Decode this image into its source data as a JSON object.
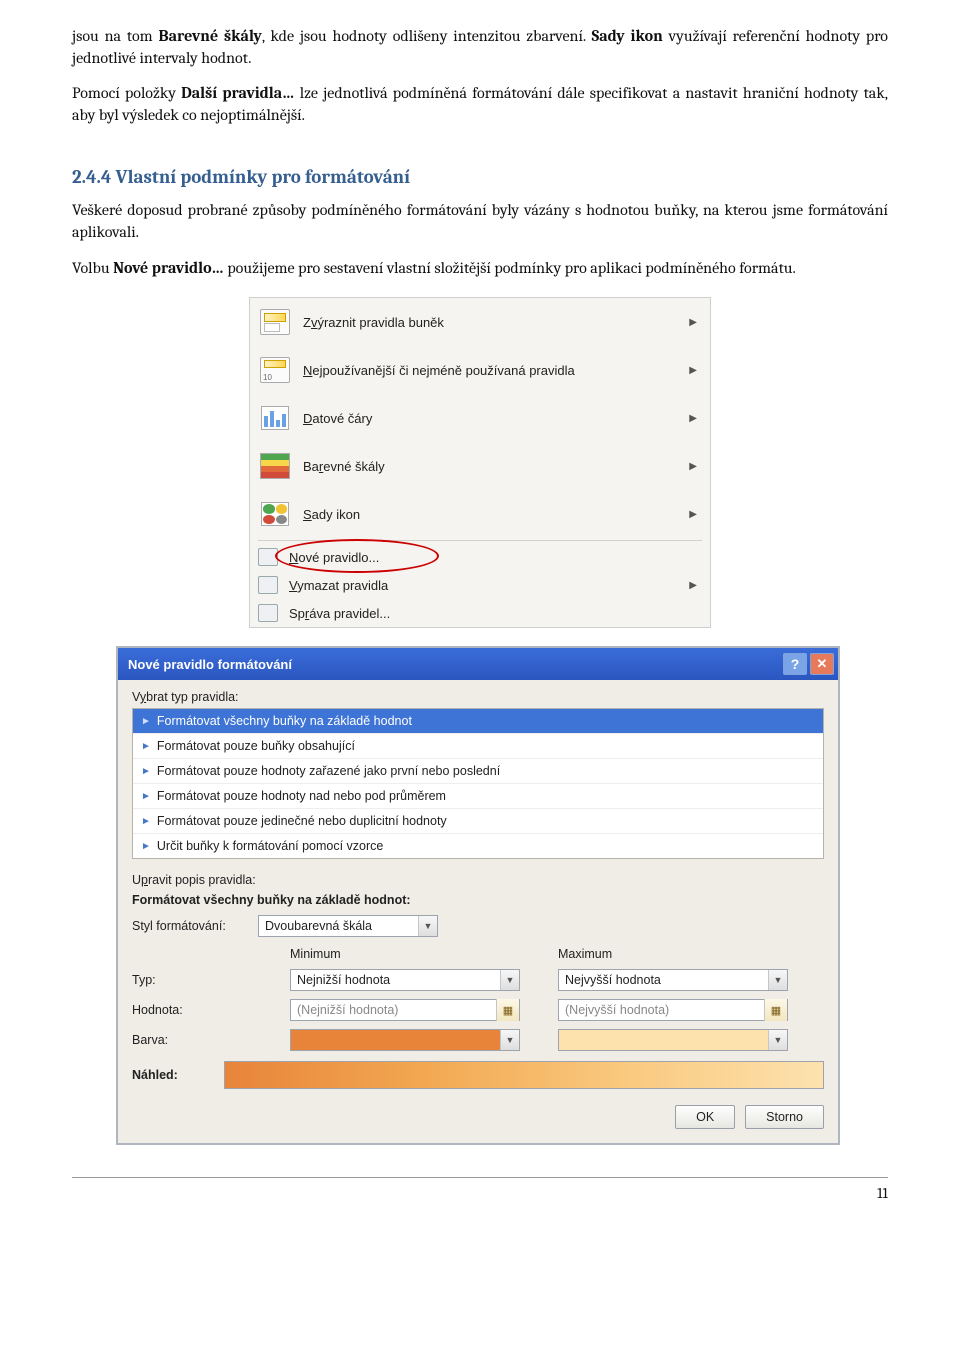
{
  "para1_pre": "jsou na tom ",
  "para1_b1": "Barevné škály",
  "para1_mid": ", kde jsou hodnoty odlišeny intenzitou zbarvení. ",
  "para1_b2": "Sady ikon",
  "para1_post": " využívají referenční hodnoty pro jednotlivé intervaly hodnot.",
  "para2_pre": "Pomocí položky ",
  "para2_b": "Další pravidla…",
  "para2_post": " lze jednotlivá podmíněná formátování dále specifikovat a nastavit hraniční hodnoty tak, aby byl výsledek co nejoptimálnější.",
  "heading": "2.4.4 Vlastní podmínky pro formátování",
  "para3": "Veškeré doposud probrané způsoby podmíněného formátování byly vázány s hodnotou buňky, na kterou jsme formátování aplikovali.",
  "para4_pre": "Volbu ",
  "para4_b": "Nové pravidlo…",
  "para4_post": " použijeme pro sestavení vlastní složitější podmínky pro aplikaci podmíněného formátu.",
  "menu": {
    "items": [
      {
        "label_pre": "Z",
        "label_ul": "v",
        "label_post": "ýraznit pravidla buněk",
        "sub": true,
        "icon": "highlight"
      },
      {
        "label_pre": "",
        "label_ul": "N",
        "label_post": "ejpoužívanější či nejméně používaná pravidla",
        "sub": true,
        "icon": "top10"
      },
      {
        "label_pre": "",
        "label_ul": "D",
        "label_post": "atové čáry",
        "sub": true,
        "icon": "bars"
      },
      {
        "label_pre": "Ba",
        "label_ul": "r",
        "label_post": "evné škály",
        "sub": true,
        "icon": "scale"
      },
      {
        "label_pre": "",
        "label_ul": "S",
        "label_post": "ady ikon",
        "sub": true,
        "icon": "icons"
      }
    ],
    "items2": [
      {
        "label_pre": "",
        "label_ul": "N",
        "label_post": "ové pravidlo...",
        "circle": true
      },
      {
        "label_pre": "",
        "label_ul": "V",
        "label_post": "ymazat pravidla",
        "sub": true
      },
      {
        "label_pre": "Sp",
        "label_ul": "r",
        "label_post": "áva pravidel..."
      }
    ]
  },
  "dialog": {
    "title": "Nové pravidlo formátování",
    "label_select_pre": "V",
    "label_select_ul": "y",
    "label_select_post": "brat typ pravidla:",
    "rules": [
      "Formátovat všechny buňky na základě hodnot",
      "Formátovat pouze buňky obsahující",
      "Formátovat pouze hodnoty zařazené jako první nebo poslední",
      "Formátovat pouze hodnoty nad nebo pod průměrem",
      "Formátovat pouze jedinečné nebo duplicitní hodnoty",
      "Určit buňky k formátování pomocí vzorce"
    ],
    "label_edit_pre": "U",
    "label_edit_ul": "p",
    "label_edit_post": "ravit popis pravidla:",
    "subhead": "Formátovat všechny buňky na základě hodnot:",
    "style_label": "Styl formátování:",
    "style_value": "Dvoubarevná škála",
    "col_min": "Minimum",
    "col_max": "Maximum",
    "row_type_pre": "T",
    "row_type_ul": "y",
    "row_type_post": "p:",
    "type_min": "Nejnižší hodnota",
    "type_max": "Nejvyšší hodnota",
    "row_value_pre": "",
    "row_value_ul": "H",
    "row_value_post": "odnota:",
    "val_min": "(Nejnižší hodnota)",
    "val_max": "(Nejvyšší hodnota)",
    "row_color_pre": "",
    "row_color_ul": "B",
    "row_color_post": "arva:",
    "color_min": "#e8843a",
    "color_max": "#fde2ae",
    "preview_label": "Náhled:",
    "btn_ok": "OK",
    "btn_cancel": "Storno"
  },
  "pagenum": "11"
}
